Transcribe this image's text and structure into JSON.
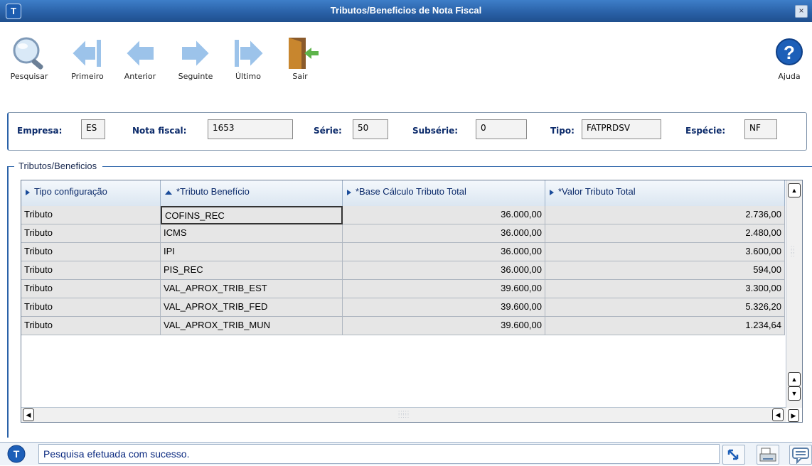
{
  "window": {
    "title": "Tributos/Beneficios de Nota Fiscal",
    "close_label": "×"
  },
  "toolbar": {
    "pesquisar": "Pesquisar",
    "primeiro": "Primeiro",
    "anterior": "Anterior",
    "seguinte": "Seguinte",
    "ultimo": "Último",
    "sair": "Sair",
    "ajuda": "Ajuda"
  },
  "header": {
    "empresa_label": "Empresa:",
    "empresa_value": "ES",
    "nota_label": "Nota fiscal:",
    "nota_value": "1653",
    "serie_label": "Série:",
    "serie_value": "50",
    "subserie_label": "Subsérie:",
    "subserie_value": "0",
    "tipo_label": "Tipo:",
    "tipo_value": "FATPRDSV",
    "especie_label": "Espécie:",
    "especie_value": "NF"
  },
  "group": {
    "label": "Tributos/Beneficios"
  },
  "grid": {
    "columns": [
      "Tipo configuração",
      "*Tributo Benefício",
      "*Base Cálculo Tributo Total",
      "*Valor Tributo Total"
    ],
    "rows": [
      [
        "Tributo",
        "COFINS_REC",
        "36.000,00",
        "2.736,00"
      ],
      [
        "Tributo",
        "ICMS",
        "36.000,00",
        "2.480,00"
      ],
      [
        "Tributo",
        "IPI",
        "36.000,00",
        "3.600,00"
      ],
      [
        "Tributo",
        "PIS_REC",
        "36.000,00",
        "594,00"
      ],
      [
        "Tributo",
        "VAL_APROX_TRIB_EST",
        "39.600,00",
        "3.300,00"
      ],
      [
        "Tributo",
        "VAL_APROX_TRIB_FED",
        "39.600,00",
        "5.326,20"
      ],
      [
        "Tributo",
        "VAL_APROX_TRIB_MUN",
        "39.600,00",
        "1.234,64"
      ]
    ]
  },
  "status": {
    "message": "Pesquisa efetuada com sucesso."
  },
  "colors": {
    "accent": "#2a62a8",
    "label": "#0b2a6a"
  }
}
